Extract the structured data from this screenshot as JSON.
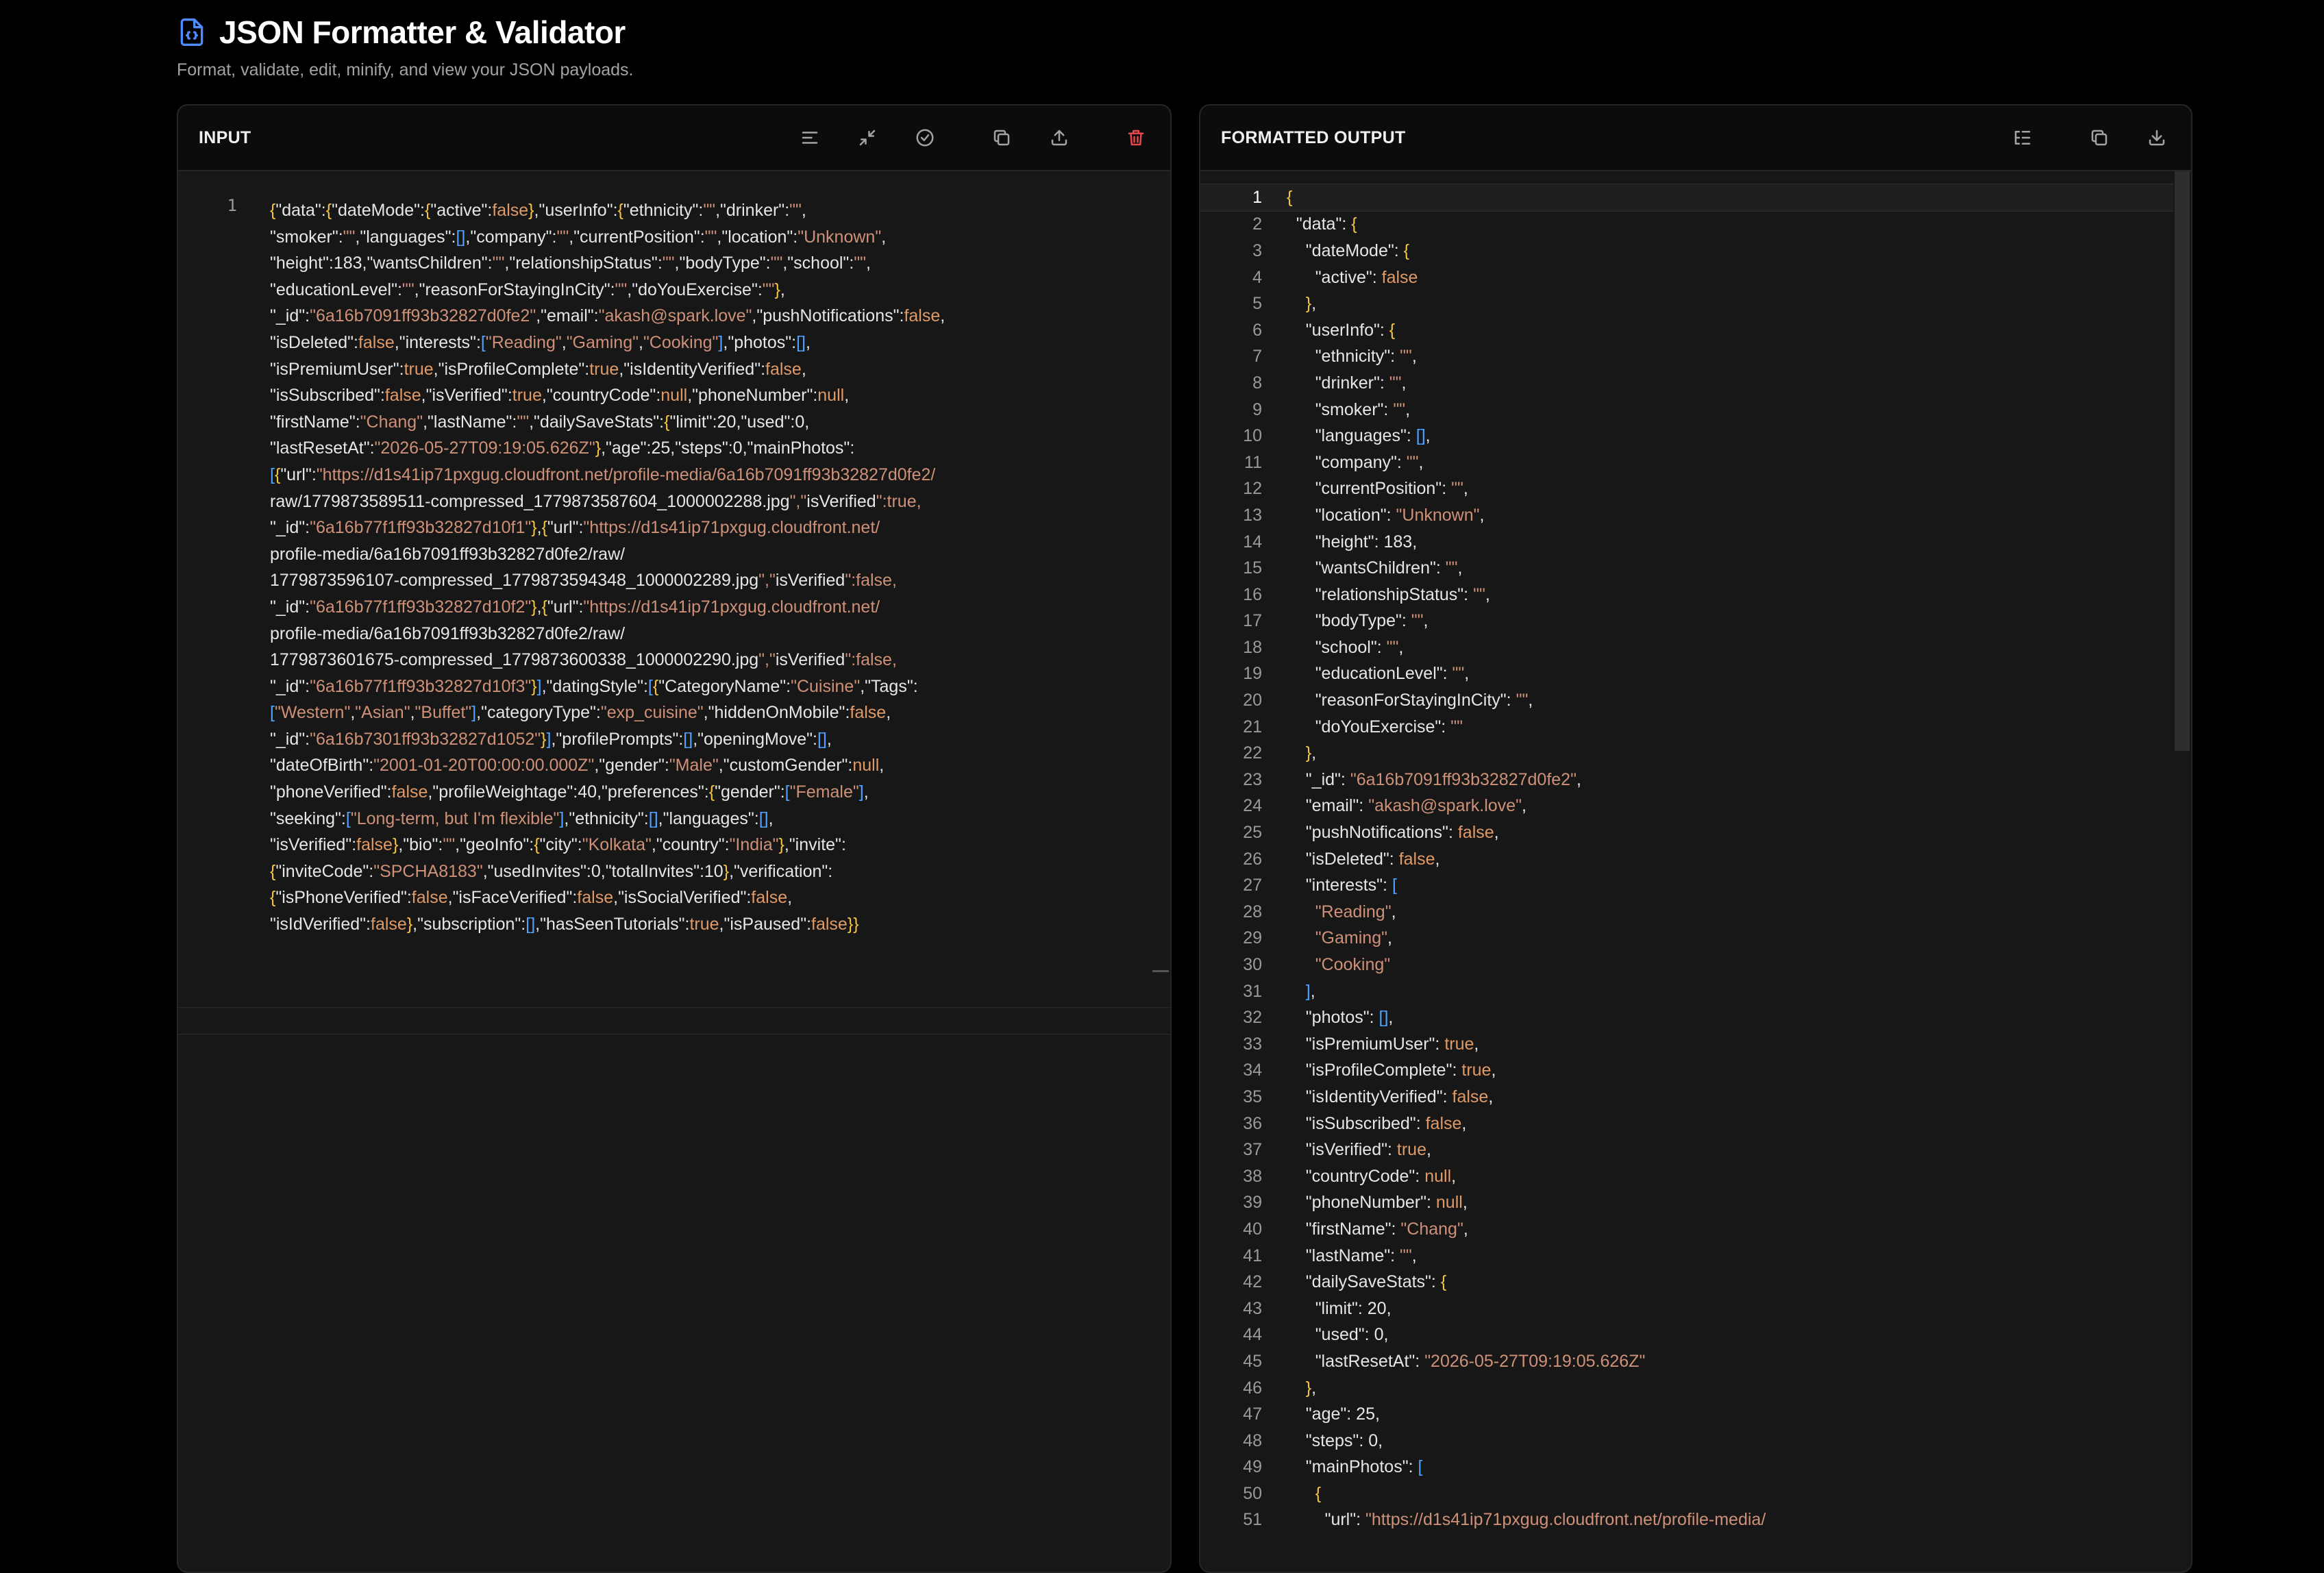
{
  "header": {
    "title": "JSON Formatter & Validator",
    "subtitle": "Format, validate, edit, minify, and view your JSON payloads."
  },
  "input_panel": {
    "title": "INPUT",
    "line_number": "1",
    "tools": [
      "format-icon",
      "minify-icon",
      "validate-icon",
      "copy-icon",
      "upload-icon",
      "trash-icon"
    ]
  },
  "output_panel": {
    "title": "FORMATTED OUTPUT",
    "tools": [
      "tree-view-icon",
      "copy-icon",
      "download-icon"
    ]
  },
  "input_lines": [
    "{\"data\":{\"dateMode\":{\"active\":false},\"userInfo\":{\"ethnicity\":\"\",\"drinker\":\"\",",
    "\"smoker\":\"\",\"languages\":[],\"company\":\"\",\"currentPosition\":\"\",\"location\":\"Unknown\",",
    "\"height\":183,\"wantsChildren\":\"\",\"relationshipStatus\":\"\",\"bodyType\":\"\",\"school\":\"\",",
    "\"educationLevel\":\"\",\"reasonForStayingInCity\":\"\",\"doYouExercise\":\"\"},",
    "\"_id\":\"6a16b7091ff93b32827d0fe2\",\"email\":\"akash@spark.love\",\"pushNotifications\":false,",
    "\"isDeleted\":false,\"interests\":[\"Reading\",\"Gaming\",\"Cooking\"],\"photos\":[],",
    "\"isPremiumUser\":true,\"isProfileComplete\":true,\"isIdentityVerified\":false,",
    "\"isSubscribed\":false,\"isVerified\":true,\"countryCode\":null,\"phoneNumber\":null,",
    "\"firstName\":\"Chang\",\"lastName\":\"\",\"dailySaveStats\":{\"limit\":20,\"used\":0,",
    "\"lastResetAt\":\"2026-05-27T09:19:05.626Z\"},\"age\":25,\"steps\":0,\"mainPhotos\":",
    "[{\"url\":\"https://d1s41ip71pxgug.cloudfront.net/profile-media/6a16b7091ff93b32827d0fe2/",
    "raw/1779873589511-compressed_1779873587604_1000002288.jpg\",\"isVerified\":true,",
    "\"_id\":\"6a16b77f1ff93b32827d10f1\"},{\"url\":\"https://d1s41ip71pxgug.cloudfront.net/",
    "profile-media/6a16b7091ff93b32827d0fe2/raw/",
    "1779873596107-compressed_1779873594348_1000002289.jpg\",\"isVerified\":false,",
    "\"_id\":\"6a16b77f1ff93b32827d10f2\"},{\"url\":\"https://d1s41ip71pxgug.cloudfront.net/",
    "profile-media/6a16b7091ff93b32827d0fe2/raw/",
    "1779873601675-compressed_1779873600338_1000002290.jpg\",\"isVerified\":false,",
    "\"_id\":\"6a16b77f1ff93b32827d10f3\"}],\"datingStyle\":[{\"CategoryName\":\"Cuisine\",\"Tags\":",
    "[\"Western\",\"Asian\",\"Buffet\"],\"categoryType\":\"exp_cuisine\",\"hiddenOnMobile\":false,",
    "\"_id\":\"6a16b7301ff93b32827d1052\"}],\"profilePrompts\":[],\"openingMove\":[],",
    "\"dateOfBirth\":\"2001-01-20T00:00:00.000Z\",\"gender\":\"Male\",\"customGender\":null,",
    "\"phoneVerified\":false,\"profileWeightage\":40,\"preferences\":{\"gender\":[\"Female\"],",
    "\"seeking\":[\"Long-term, but I'm flexible\"],\"ethnicity\":[],\"languages\":[],",
    "\"isVerified\":false},\"bio\":\"\",\"geoInfo\":{\"city\":\"Kolkata\",\"country\":\"India\"},\"invite\":",
    "{\"inviteCode\":\"SPCHA8183\",\"usedInvites\":0,\"totalInvites\":10},\"verification\":",
    "{\"isPhoneVerified\":false,\"isFaceVerified\":false,\"isSocialVerified\":false,",
    "\"isIdVerified\":false},\"subscription\":[],\"hasSeenTutorials\":true,\"isPaused\":false}}"
  ],
  "output_lines": [
    "{",
    "  \"data\": {",
    "    \"dateMode\": {",
    "      \"active\": false",
    "    },",
    "    \"userInfo\": {",
    "      \"ethnicity\": \"\",",
    "      \"drinker\": \"\",",
    "      \"smoker\": \"\",",
    "      \"languages\": [],",
    "      \"company\": \"\",",
    "      \"currentPosition\": \"\",",
    "      \"location\": \"Unknown\",",
    "      \"height\": 183,",
    "      \"wantsChildren\": \"\",",
    "      \"relationshipStatus\": \"\",",
    "      \"bodyType\": \"\",",
    "      \"school\": \"\",",
    "      \"educationLevel\": \"\",",
    "      \"reasonForStayingInCity\": \"\",",
    "      \"doYouExercise\": \"\"",
    "    },",
    "    \"_id\": \"6a16b7091ff93b32827d0fe2\",",
    "    \"email\": \"akash@spark.love\",",
    "    \"pushNotifications\": false,",
    "    \"isDeleted\": false,",
    "    \"interests\": [",
    "      \"Reading\",",
    "      \"Gaming\",",
    "      \"Cooking\"",
    "    ],",
    "    \"photos\": [],",
    "    \"isPremiumUser\": true,",
    "    \"isProfileComplete\": true,",
    "    \"isIdentityVerified\": false,",
    "    \"isSubscribed\": false,",
    "    \"isVerified\": true,",
    "    \"countryCode\": null,",
    "    \"phoneNumber\": null,",
    "    \"firstName\": \"Chang\",",
    "    \"lastName\": \"\",",
    "    \"dailySaveStats\": {",
    "      \"limit\": 20,",
    "      \"used\": 0,",
    "      \"lastResetAt\": \"2026-05-27T09:19:05.626Z\"",
    "    },",
    "    \"age\": 25,",
    "    \"steps\": 0,",
    "    \"mainPhotos\": [",
    "      {",
    "        \"url\": \"https://d1s41ip71pxgug.cloudfront.net/profile-media/"
  ],
  "colors": {
    "background": "#000000",
    "panel": "#171717",
    "key": "#e6e6e6",
    "string": "#ce9178",
    "boolean": "#e09a66",
    "brace": "#f5c542",
    "bracket": "#4fa3ff",
    "danger": "#e5484d",
    "accent": "#4f8cff"
  }
}
